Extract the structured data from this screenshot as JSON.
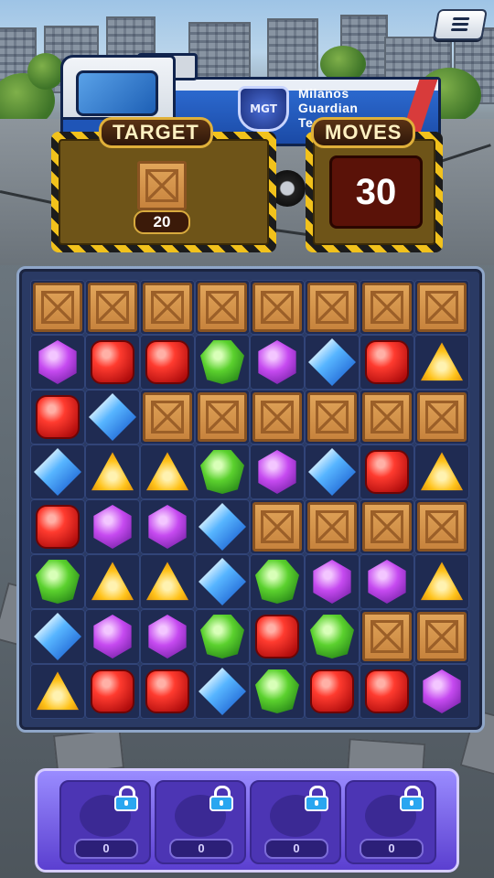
{
  "header": {
    "menu_icon": "hamburger-menu-icon",
    "truck_logo": "MGT",
    "truck_text_line1": "Milanos",
    "truck_text_line2": "Guardian",
    "truck_text_line3": "Team"
  },
  "target": {
    "label": "TARGET",
    "item": "wooden-crate",
    "count": "20"
  },
  "moves": {
    "label": "MOVES",
    "value": "30"
  },
  "board": {
    "rows": 8,
    "cols": 8,
    "grid": [
      [
        "crate",
        "crate",
        "crate",
        "crate",
        "crate",
        "crate",
        "crate",
        "crate"
      ],
      [
        "purple",
        "red",
        "red",
        "green",
        "purple",
        "blue",
        "red",
        "yellow"
      ],
      [
        "red",
        "blue",
        "crate",
        "crate",
        "crate",
        "crate",
        "crate",
        "crate"
      ],
      [
        "blue",
        "yellow",
        "yellow",
        "green",
        "purple",
        "blue",
        "red",
        "yellow"
      ],
      [
        "red",
        "purple",
        "purple",
        "blue",
        "crate",
        "crate",
        "crate",
        "crate"
      ],
      [
        "green",
        "yellow",
        "yellow",
        "blue",
        "green",
        "purple",
        "purple",
        "yellow"
      ],
      [
        "blue",
        "purple",
        "purple",
        "green",
        "red",
        "green",
        "crate",
        "crate"
      ],
      [
        "yellow",
        "red",
        "red",
        "blue",
        "green",
        "red",
        "red",
        "purple"
      ]
    ]
  },
  "boosters": [
    {
      "icon": "locked-booster-1-icon",
      "count": "0"
    },
    {
      "icon": "locked-booster-2-icon",
      "count": "0"
    },
    {
      "icon": "locked-booster-3-icon",
      "count": "0"
    },
    {
      "icon": "locked-booster-4-icon",
      "count": "0"
    }
  ],
  "colors": {
    "panel_yellow": "#f2c21c",
    "board_bg": "#2a3a64",
    "booster_bar": "#5b3fd0"
  }
}
